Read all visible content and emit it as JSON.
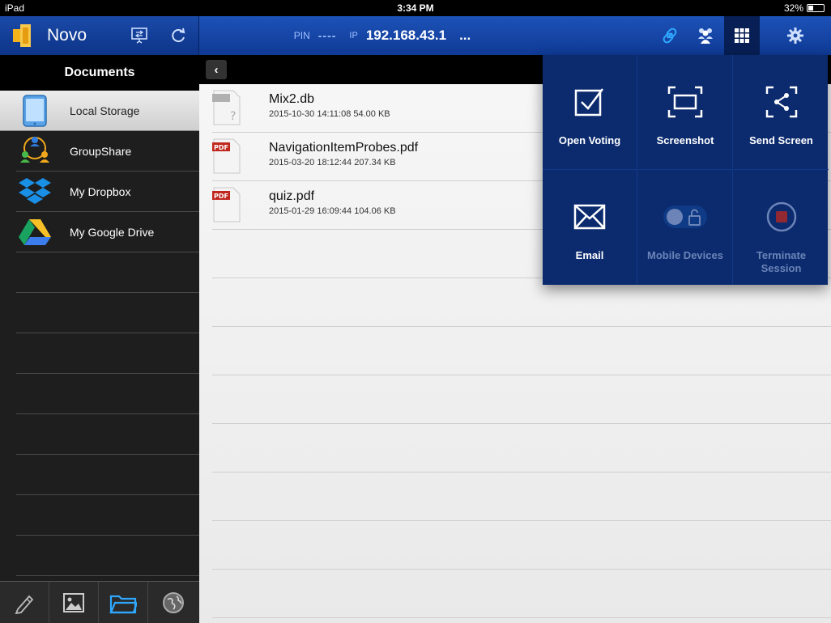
{
  "status_bar": {
    "device": "iPad",
    "time": "3:34 PM",
    "battery": "32%",
    "battery_level": 0.32
  },
  "header": {
    "app_name": "Novo",
    "pin_label": "PIN",
    "pin_value": "----",
    "ip_label": "IP",
    "ip_value": "192.168.43.1",
    "ip_more": "..."
  },
  "sidebar": {
    "title": "Documents",
    "items": [
      {
        "label": "Local Storage",
        "icon": "tablet-icon",
        "active": true
      },
      {
        "label": "GroupShare",
        "icon": "group-share-icon"
      },
      {
        "label": "My Dropbox",
        "icon": "dropbox-icon"
      },
      {
        "label": "My Google Drive",
        "icon": "google-drive-icon"
      }
    ],
    "toolbar": [
      "pencil-icon",
      "image-icon",
      "folder-icon",
      "globe-icon"
    ]
  },
  "files": [
    {
      "name": "Mix2.db",
      "meta": "2015-10-30 14:11:08  54.00 KB",
      "type": "unknown",
      "badge": ""
    },
    {
      "name": "NavigationItemProbes.pdf",
      "meta": "2015-03-20 18:12:44  207.34 KB",
      "type": "pdf",
      "badge": "PDF"
    },
    {
      "name": "quiz.pdf",
      "meta": "2015-01-29 16:09:44  104.06 KB",
      "type": "pdf",
      "badge": "PDF"
    }
  ],
  "popup": {
    "items": [
      {
        "label": "Open Voting",
        "icon": "voting-checkbox-icon",
        "enabled": true
      },
      {
        "label": "Screenshot",
        "icon": "screenshot-icon",
        "enabled": true
      },
      {
        "label": "Send Screen",
        "icon": "send-screen-icon",
        "enabled": true
      },
      {
        "label": "Email",
        "icon": "email-icon",
        "enabled": true
      },
      {
        "label": "Mobile Devices",
        "icon": "mobile-lock-toggle-icon",
        "enabled": false
      },
      {
        "label": "Terminate Session",
        "icon": "stop-icon",
        "enabled": false
      }
    ]
  },
  "colors": {
    "header_blue": "#1d52b8",
    "popup_navy": "#0b2b6e",
    "pdf_red": "#c0281e",
    "accent_cyan": "#2fa8ff"
  }
}
